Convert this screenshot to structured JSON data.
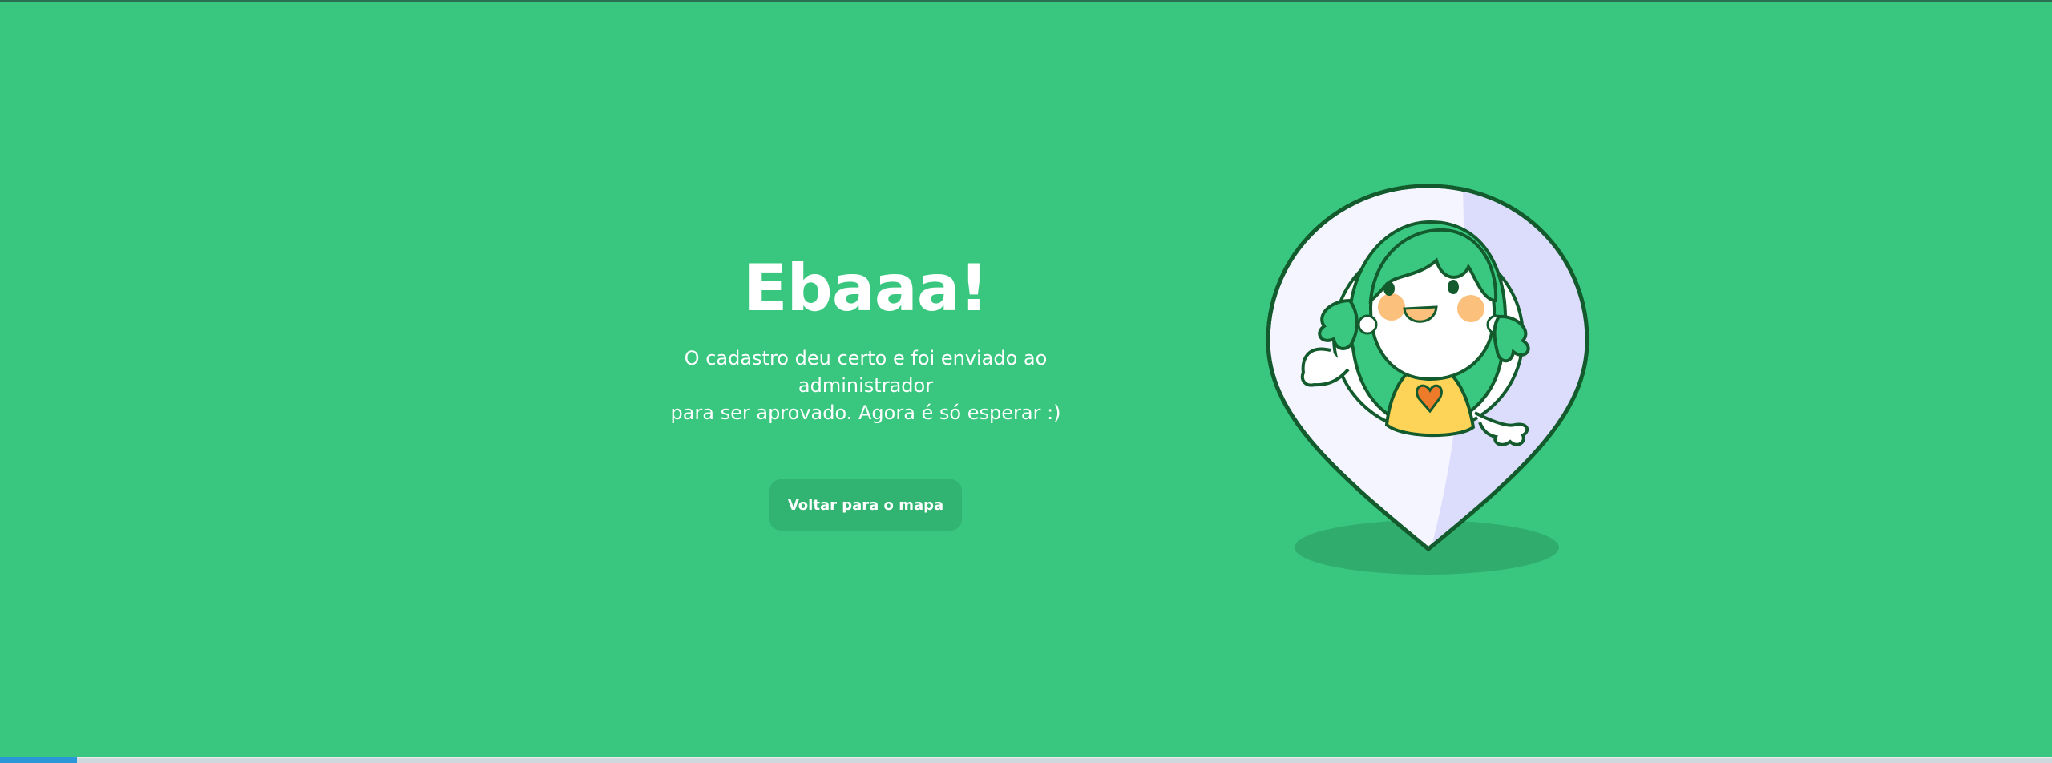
{
  "success": {
    "title": "Ebaaa!",
    "message_line1": "O cadastro deu certo e foi enviado ao administrador",
    "message_line2": "para ser aprovado. Agora é só esperar :)",
    "button_label": "Voltar para o mapa"
  },
  "illustration": {
    "icon": "map-pin-character-icon"
  },
  "colors": {
    "background": "#39c77f",
    "button": "#31b371",
    "text": "#ffffff",
    "outline": "#125a2b"
  }
}
